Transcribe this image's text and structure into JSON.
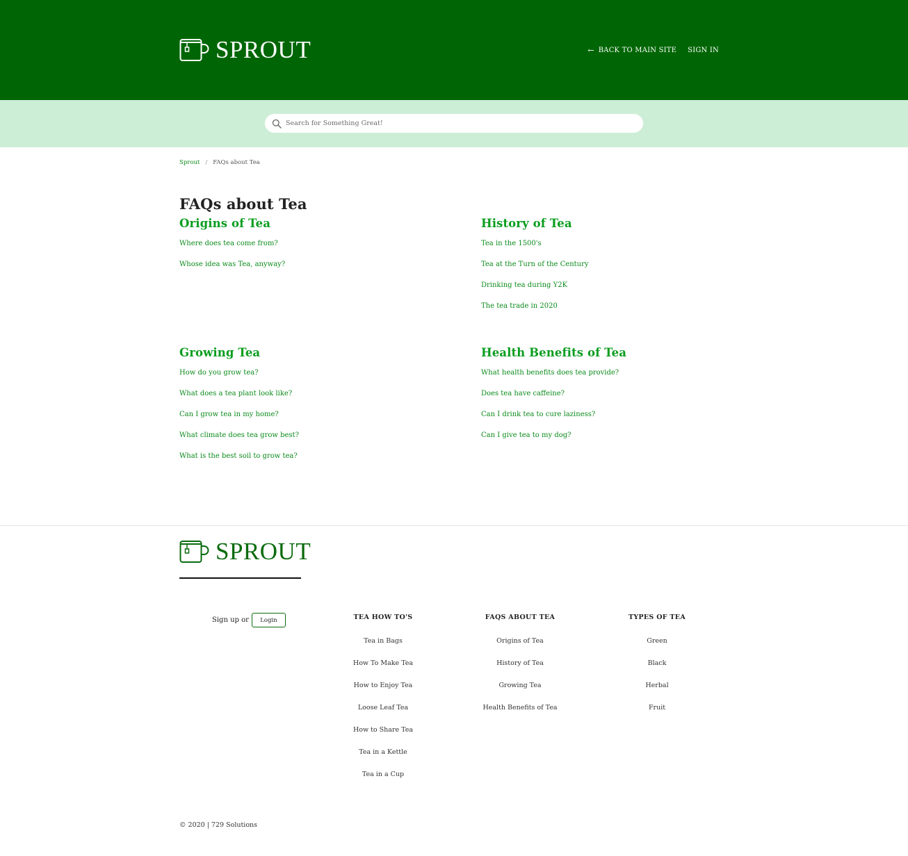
{
  "brand": {
    "name": "SPROUT",
    "header_bg": "#006605",
    "search_band_bg": "#cdeed6",
    "link_color": "#0a9d1f"
  },
  "header": {
    "back_label": "BACK TO MAIN SITE",
    "back_icon": "arrow-left-icon",
    "signin_label": "SIGN IN"
  },
  "search": {
    "placeholder": "Search for Something Great!",
    "icon": "search-icon"
  },
  "breadcrumb": {
    "home": "Sprout",
    "separator": "/",
    "current": "FAQs about Tea"
  },
  "page": {
    "title": "FAQs about Tea"
  },
  "sections": [
    {
      "title": "Origins of Tea",
      "links": [
        "Where does tea come from?",
        "Whose idea was Tea, anyway?"
      ]
    },
    {
      "title": "History of Tea",
      "links": [
        "Tea in the 1500's",
        "Tea at the Turn of the Century",
        "Drinking tea during Y2K",
        "The tea trade in 2020"
      ]
    },
    {
      "title": "Growing Tea",
      "links": [
        "How do you grow tea?",
        "What does a tea plant look like?",
        "Can I grow tea in my home?",
        "What climate does tea grow best?",
        "What is the best soil to grow tea?"
      ]
    },
    {
      "title": "Health Benefits of Tea",
      "links": [
        "What health benefits does tea provide?",
        "Does tea have caffeine?",
        "Can I drink tea to cure laziness?",
        "Can I give tea to my dog?"
      ]
    }
  ],
  "footer": {
    "signup_text": "Sign up or",
    "login_label": "Login",
    "columns": [
      {
        "heading": "TEA HOW TO'S",
        "items": [
          "Tea in Bags",
          "How To Make Tea",
          "How to Enjoy Tea",
          "Loose Leaf Tea",
          "How to Share Tea",
          "Tea in a Kettle",
          "Tea in a Cup"
        ]
      },
      {
        "heading": "FAQS ABOUT TEA",
        "items": [
          "Origins of Tea",
          "History of Tea",
          "Growing Tea",
          "Health Benefits of Tea"
        ]
      },
      {
        "heading": "TYPES OF TEA",
        "items": [
          "Green",
          "Black",
          "Herbal",
          "Fruit"
        ]
      }
    ],
    "copyright": "© 2020 | 729 Solutions"
  }
}
